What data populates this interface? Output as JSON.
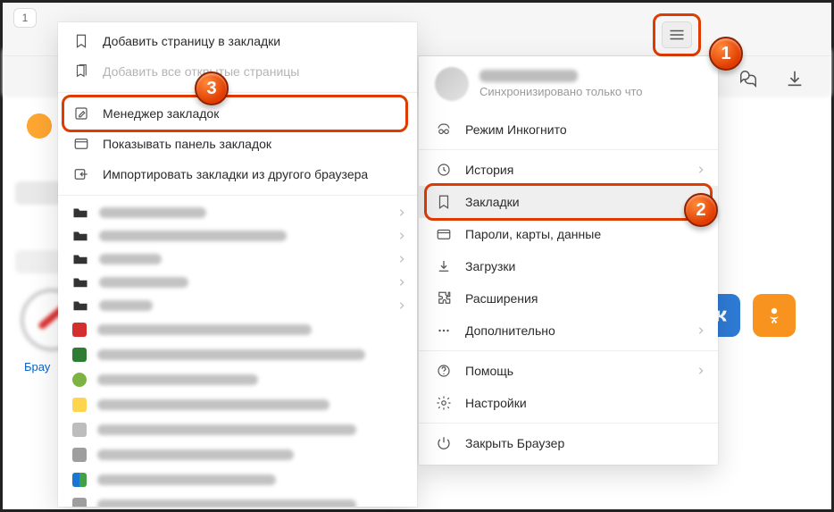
{
  "window": {
    "tab_count": "1"
  },
  "user": {
    "sync_status": "Синхронизировано только что"
  },
  "main_menu": {
    "incognito": "Режим Инкогнито",
    "history": "История",
    "bookmarks": "Закладки",
    "passwords": "Пароли, карты, данные",
    "downloads": "Загрузки",
    "extensions": "Расширения",
    "more": "Дополнительно",
    "help": "Помощь",
    "settings": "Настройки",
    "close": "Закрыть Браузер"
  },
  "bookmarks_menu": {
    "add_page": "Добавить страницу в закладки",
    "add_all": "Добавить все открытые страницы",
    "manager": "Менеджер закладок",
    "show_bar": "Показывать панель закладок",
    "import": "Импортировать закладки из другого браузера"
  },
  "page": {
    "brau": "Брау"
  },
  "badge": {
    "one": "1",
    "two": "2",
    "three": "3"
  }
}
